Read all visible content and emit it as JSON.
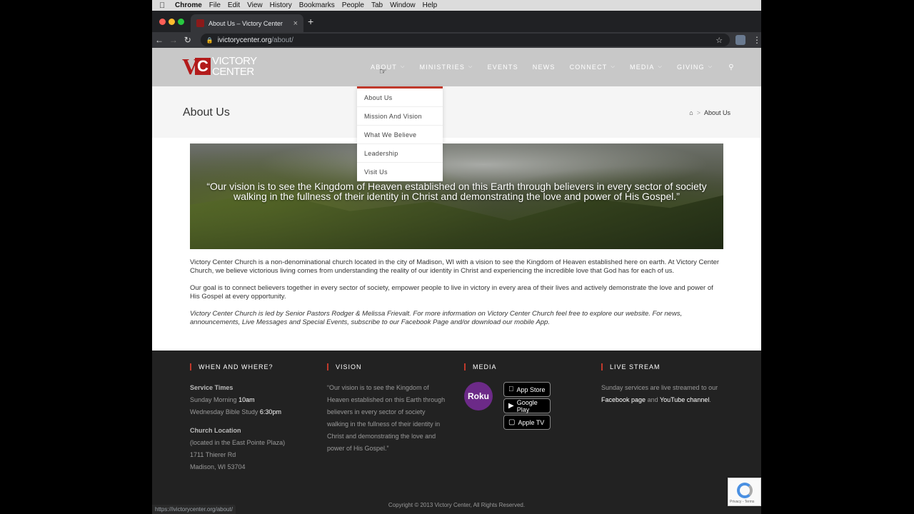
{
  "menubar": {
    "app": "Chrome",
    "items": [
      "File",
      "Edit",
      "View",
      "History",
      "Bookmarks",
      "People",
      "Tab",
      "Window",
      "Help"
    ]
  },
  "browser": {
    "tab_title": "About Us – Victory Center",
    "url_host": "ivictorycenter.org",
    "url_path": "/about/",
    "status_url": "https://ivictorycenter.org/about/"
  },
  "site": {
    "logo_line1": "VICTORY",
    "logo_line2": "CENTER",
    "nav": [
      {
        "label": "ABOUT",
        "dropdown": true
      },
      {
        "label": "MINISTRIES",
        "dropdown": true
      },
      {
        "label": "EVENTS",
        "dropdown": false
      },
      {
        "label": "NEWS",
        "dropdown": false
      },
      {
        "label": "CONNECT",
        "dropdown": true
      },
      {
        "label": "MEDIA",
        "dropdown": true
      },
      {
        "label": "GIVING",
        "dropdown": true
      }
    ],
    "about_dropdown": [
      "About Us",
      "Mission And Vision",
      "What We Believe",
      "Leadership",
      "Visit Us"
    ]
  },
  "page": {
    "title": "About Us",
    "breadcrumb_current": "About Us",
    "hero_quote": "“Our vision is to see the Kingdom of Heaven established on this Earth through believers in every sector of society walking in the fullness of their identity in Christ and demonstrating the love and power of His Gospel.”",
    "paragraphs": [
      "Victory Center Church is a non-denominational church located in the city of Madison, WI with a vision to see the Kingdom of Heaven established here on earth. At Victory Center Church, we believe victorious living comes from understanding the reality of our identity in Christ and experiencing the incredible love that God has for each of us.",
      "Our goal is to connect believers together in every sector of society, empower people to live in victory in every area of their lives and actively demonstrate the love and power of His Gospel at every opportunity."
    ],
    "italic_paragraph": "Victory Center Church is led by Senior Pastors Rodger & Melissa Frievalt. For more information on Victory Center Church feel free to explore our website. For news, announcements, Live Messages and Special Events, subscribe to our Facebook Page and/or download our mobile App."
  },
  "footer": {
    "when": {
      "heading": "WHEN AND WHERE?",
      "service_times_label": "Service Times",
      "sunday_label": "Sunday Morning",
      "sunday_time": "10am",
      "wednesday_label": "Wednesday Bible Study",
      "wednesday_time": "6:30pm",
      "location_label": "Church Location",
      "location_note": "(located in the East Pointe Plaza)",
      "address1": "1711 Thierer Rd",
      "address2": "Madison, WI 53704"
    },
    "vision": {
      "heading": "VISION",
      "text": "“Our vision is to see the Kingdom of Heaven established on this Earth through believers in every sector of society walking in the fullness of their identity in Christ and demonstrating the love and power of His Gospel.”"
    },
    "media": {
      "heading": "MEDIA",
      "roku": "Roku",
      "app_store": "App Store",
      "google_play": "Google Play",
      "apple_tv": "Apple TV"
    },
    "live": {
      "heading": "LIVE STREAM",
      "text1": "Sunday services are live streamed to our",
      "facebook": "Facebook page",
      "and": "and",
      "youtube": "YouTube channel",
      "end": "."
    },
    "copyright": "Copyright © 2013 Victory Center, All Rights Reserved."
  },
  "colors": {
    "accent": "#c0392b",
    "header_bg": "#c8c8c8",
    "footer_bg": "#222222"
  }
}
